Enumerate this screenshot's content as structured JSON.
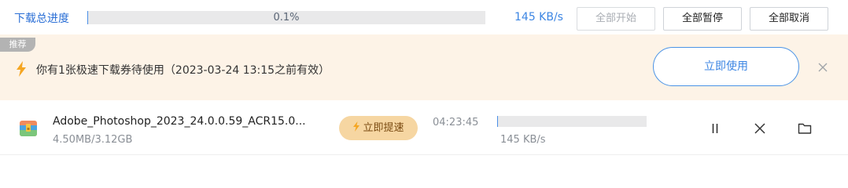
{
  "top": {
    "title": "下载总进度",
    "progress_text": "0.1%",
    "progress_value": 0.1,
    "speed": "145 KB/s",
    "start_all": "全部开始",
    "pause_all": "全部暂停",
    "cancel_all": "全部取消"
  },
  "banner": {
    "tag": "推荐",
    "message": "你有1张极速下载券待使用（2023-03-24 13:15之前有效）",
    "use_button": "立即使用"
  },
  "download": {
    "file_name": "Adobe_Photoshop_2023_24.0.0.59_ACR15.0...",
    "size": "4.50MB/3.12GB",
    "boost_label": "立即提速",
    "time_left": "04:23:45",
    "speed": "145 KB/s",
    "progress_value": 0.1
  },
  "colors": {
    "accent": "#3d86e3",
    "banner_bg": "#fdf3e7",
    "boost_bg": "#f6d6a2",
    "bolt": "#f5a623"
  }
}
